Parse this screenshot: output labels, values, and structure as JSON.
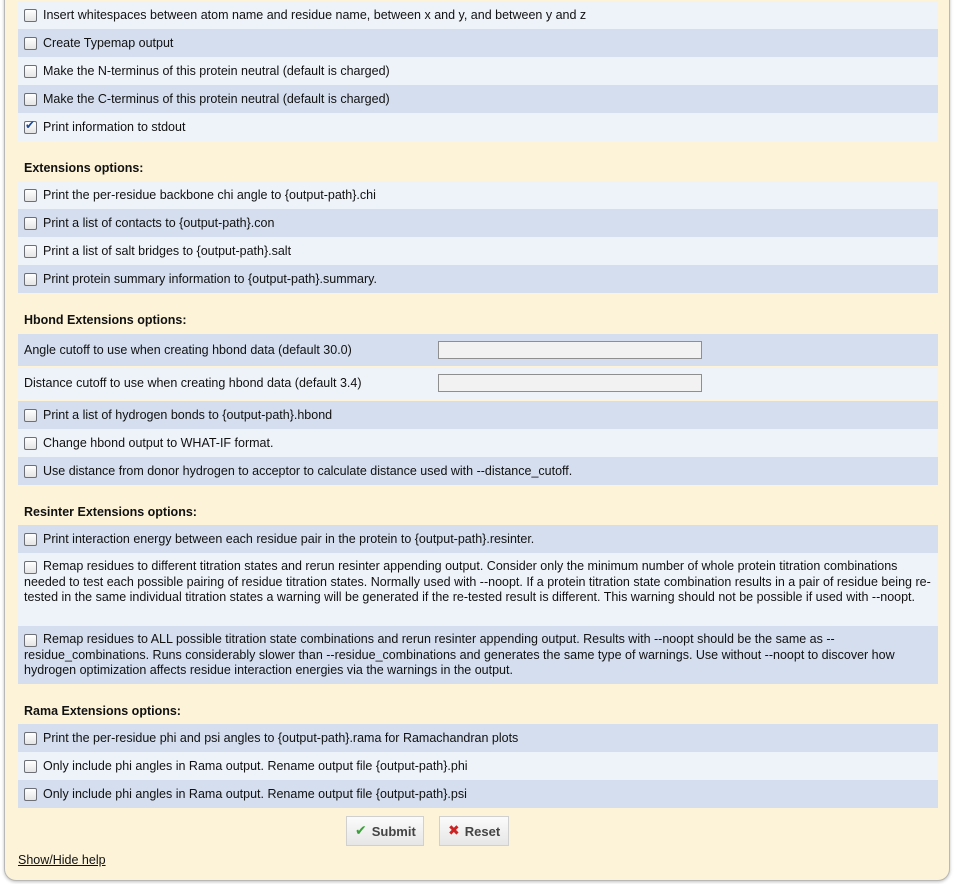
{
  "options_top": [
    {
      "label": "Insert whitespaces between atom name and residue name, between x and y, and between y and z",
      "checked": false
    },
    {
      "label": "Create Typemap output",
      "checked": false
    },
    {
      "label": "Make the N-terminus of this protein neutral (default is charged)",
      "checked": false
    },
    {
      "label": "Make the C-terminus of this protein neutral (default is charged)",
      "checked": false
    },
    {
      "label": "Print information to stdout",
      "checked": true
    }
  ],
  "extensions": {
    "heading": "Extensions options:",
    "items": [
      {
        "label": "Print the per-residue backbone chi angle to {output-path}.chi",
        "checked": false
      },
      {
        "label": "Print a list of contacts to {output-path}.con",
        "checked": false
      },
      {
        "label": "Print a list of salt bridges to {output-path}.salt",
        "checked": false
      },
      {
        "label": "Print protein summary information to {output-path}.summary.",
        "checked": false
      }
    ]
  },
  "hbond": {
    "heading": "Hbond Extensions options:",
    "angle_label": "Angle cutoff to use when creating hbond data (default 30.0)",
    "angle_value": "",
    "distance_label": "Distance cutoff to use when creating hbond data (default 3.4)",
    "distance_value": "",
    "items": [
      {
        "label": "Print a list of hydrogen bonds to {output-path}.hbond",
        "checked": false
      },
      {
        "label": "Change hbond output to WHAT-IF format.",
        "checked": false
      },
      {
        "label": "Use distance from donor hydrogen to acceptor to calculate distance used with --distance_cutoff.",
        "checked": false
      }
    ]
  },
  "resinter": {
    "heading": "Resinter Extensions options:",
    "items": [
      {
        "label": "Print interaction energy between each residue pair in the protein to {output-path}.resinter.",
        "checked": false
      },
      {
        "label": "Remap residues to different titration states and rerun resinter appending output. Consider only the minimum number of whole protein titration combinations needed to test each possible pairing of residue titration states. Normally used with --noopt. If a protein titration state combination results in a pair of residue being re-tested in the same individual titration states a warning will be generated if the re-tested result is different. This warning should not be possible if used with --noopt.",
        "checked": false
      },
      {
        "label": "Remap residues to ALL possible titration state combinations and rerun resinter appending output. Results with --noopt should be the same as --residue_combinations. Runs considerably slower than --residue_combinations and generates the same type of warnings. Use without --noopt to discover how hydrogen optimization affects residue interaction energies via the warnings in the output.",
        "checked": false
      }
    ]
  },
  "rama": {
    "heading": "Rama Extensions options:",
    "items": [
      {
        "label": "Print the per-residue phi and psi angles to {output-path}.rama for Ramachandran plots",
        "checked": false
      },
      {
        "label": "Only include phi angles in Rama output. Rename output file {output-path}.phi",
        "checked": false
      },
      {
        "label": "Only include phi angles in Rama output. Rename output file {output-path}.psi",
        "checked": false
      }
    ]
  },
  "actions": {
    "submit_label": "Submit",
    "reset_label": "Reset",
    "submit_icon": "checkmark-icon",
    "reset_icon": "x-icon"
  },
  "help_link": "Show/Hide help"
}
